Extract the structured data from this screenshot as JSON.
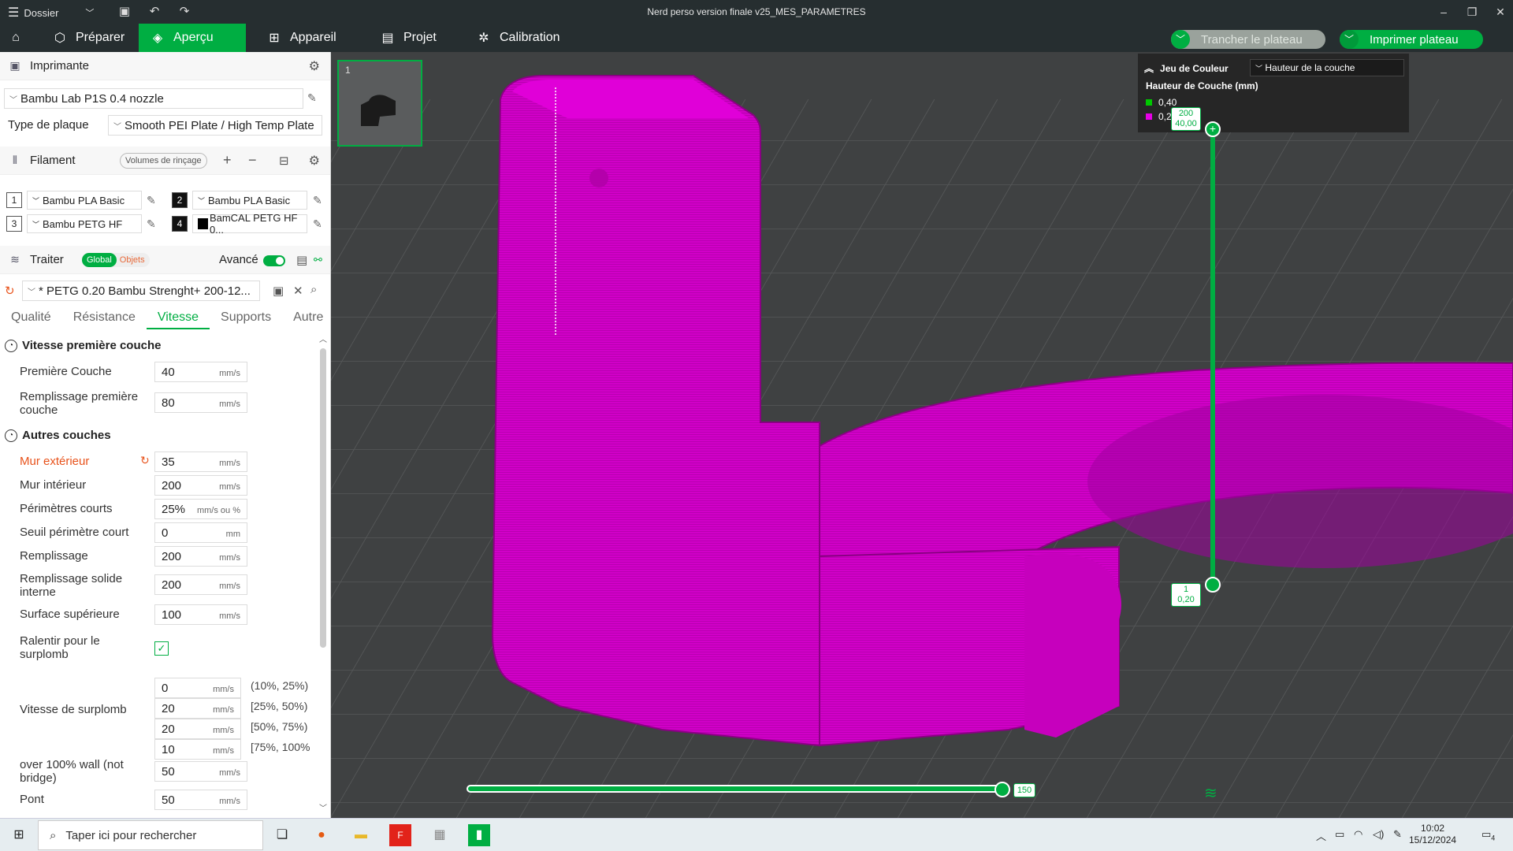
{
  "titlebar": {
    "menu_label": "Dossier",
    "title": "Nerd perso version finale v25_MES_PARAMETRES"
  },
  "nav": {
    "tabs": [
      {
        "label": "Préparer"
      },
      {
        "label": "Aperçu"
      },
      {
        "label": "Appareil"
      },
      {
        "label": "Projet"
      },
      {
        "label": "Calibration"
      }
    ],
    "slice_button": "Trancher le plateau",
    "print_button": "Imprimer plateau"
  },
  "printer": {
    "section_title": "Imprimante",
    "printer_name": "Bambu Lab P1S 0.4 nozzle",
    "plate_label": "Type de plaque",
    "plate_value": "Smooth PEI Plate / High Temp Plate"
  },
  "filament": {
    "section_title": "Filament",
    "flush_button": "Volumes de rinçage",
    "slots": [
      {
        "num": "1",
        "name": "Bambu PLA Basic"
      },
      {
        "num": "2",
        "name": "Bambu PLA Basic"
      },
      {
        "num": "3",
        "name": "Bambu PETG HF"
      },
      {
        "num": "4",
        "name": "BamCAL PETG HF 0..."
      }
    ]
  },
  "process": {
    "section_title": "Traiter",
    "global_label": "Global",
    "objects_label": "Objets",
    "advanced_label": "Avancé",
    "profile": "* PETG 0.20 Bambu Strenght+ 200-12...",
    "tabs": [
      "Qualité",
      "Résistance",
      "Vitesse",
      "Supports",
      "Autre"
    ],
    "active_tab": "Vitesse"
  },
  "speed": {
    "group1_title": "Vitesse première couche",
    "first_layer_label": "Première Couche",
    "first_layer_value": "40",
    "first_infill_label": "Remplissage première couche",
    "first_infill_value": "80",
    "group2_title": "Autres couches",
    "outer_wall_label": "Mur extérieur",
    "outer_wall_value": "35",
    "inner_wall_label": "Mur intérieur",
    "inner_wall_value": "200",
    "small_perim_label": "Périmètres courts",
    "small_perim_value": "25%",
    "small_perim_thresh_label": "Seuil périmètre court",
    "small_perim_thresh_value": "0",
    "infill_label": "Remplissage",
    "infill_value": "200",
    "solid_infill_label": "Remplissage solide interne",
    "solid_infill_value": "200",
    "top_surface_label": "Surface supérieure",
    "top_surface_value": "100",
    "slow_overhang_label": "Ralentir pour le surplomb",
    "overhang_label": "Vitesse de surplomb",
    "overhang_rows": [
      {
        "value": "0",
        "range": "(10%, 25%)"
      },
      {
        "value": "20",
        "range": "[25%, 50%)"
      },
      {
        "value": "20",
        "range": "[50%, 75%)"
      },
      {
        "value": "10",
        "range": "[75%, 100%"
      }
    ],
    "over100_label": "over 100% wall (not bridge)",
    "over100_value": "50",
    "bridge_label": "Pont",
    "bridge_value": "50",
    "unit_mms": "mm/s",
    "unit_mm": "mm",
    "unit_mms_pct": "mm/s ou %"
  },
  "viewport": {
    "plate_number": "1",
    "legend_title": "Jeu de Couleur",
    "legend_select": "Hauteur de la couche",
    "legend_subtitle": "Hauteur de Couche (mm)",
    "legend_items": [
      {
        "label": "0,40",
        "color": "#00c800"
      },
      {
        "label": "0,20",
        "color": "#e600e6"
      }
    ],
    "vslider_top_1": "200",
    "vslider_top_2": "40,00",
    "vslider_bot_1": "1",
    "vslider_bot_2": "0,20",
    "hslider_value": "150",
    "model_color": "#d100c8",
    "accent": "#00ae42"
  },
  "taskbar": {
    "search_placeholder": "Taper ici pour rechercher",
    "time": "10:02",
    "date": "15/12/2024",
    "notif_count": "4"
  }
}
